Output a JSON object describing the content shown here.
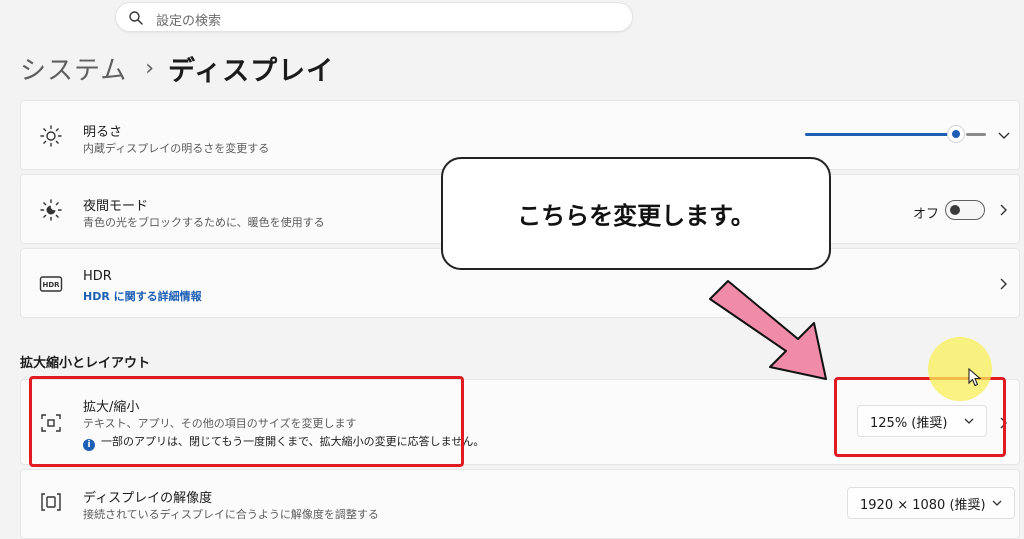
{
  "search": {
    "placeholder": "設定の検索",
    "icon": "search-icon"
  },
  "breadcrumb": {
    "parent": "システム",
    "separator": "›",
    "current": "ディスプレイ"
  },
  "brightness": {
    "title": "明るさ",
    "description": "内蔵ディスプレイの明るさを変更する",
    "level_percent": 85,
    "icon": "sun-icon"
  },
  "night_light": {
    "title": "夜間モード",
    "description": "青色の光をブロックするために、暖色を使用する",
    "toggle_label": "オフ",
    "toggle_on": false,
    "icon": "night-light-icon"
  },
  "hdr": {
    "title": "HDR",
    "link": "HDR に関する詳細情報",
    "icon": "hdr-icon"
  },
  "section": {
    "title": "拡大縮小とレイアウト"
  },
  "scale": {
    "title": "拡大/縮小",
    "description": "テキスト、アプリ、その他の項目のサイズを変更します",
    "info": "一部のアプリは、閉じてもう一度開くまで、拡大縮小の変更に応答しません。",
    "value": "125% (推奨)",
    "icon": "scale-icon"
  },
  "resolution": {
    "title": "ディスプレイの解像度",
    "description": "接続されているディスプレイに合うように解像度を調整する",
    "value": "1920 × 1080 (推奨)",
    "icon": "resolution-icon"
  },
  "overlay": {
    "callout_text": "こちらを変更します。",
    "highlight_color": "#e11b22",
    "arrow_color": "#f08caa"
  },
  "colors": {
    "accent": "#1d5fb4",
    "link": "#1d5fb4"
  }
}
